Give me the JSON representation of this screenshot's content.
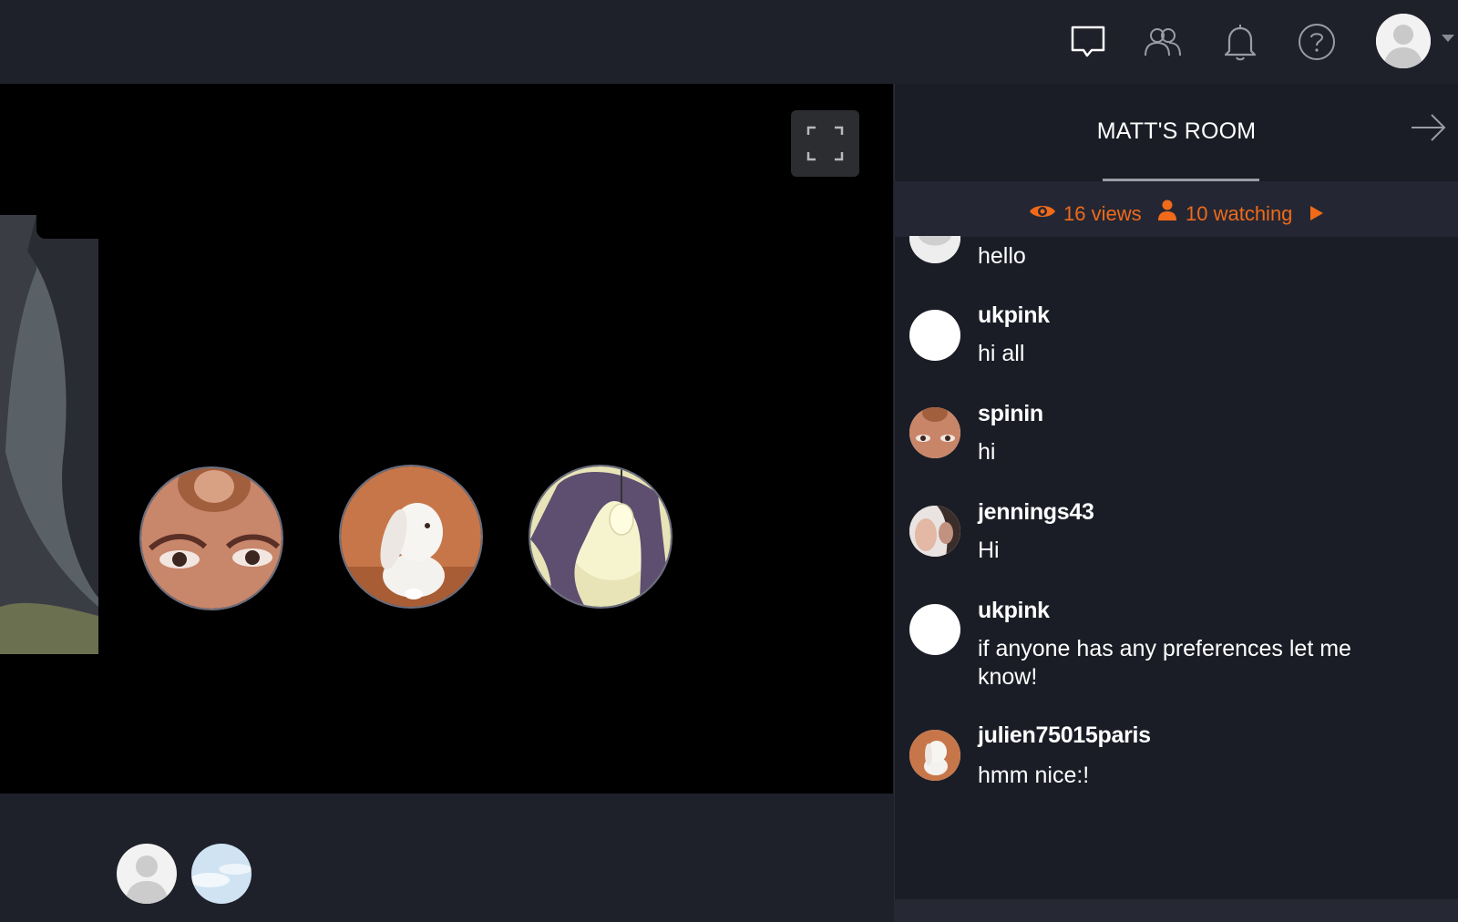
{
  "header": {
    "icons": [
      "chat-icon",
      "people-icon",
      "bell-icon",
      "help-icon"
    ],
    "profile_menu": "user-avatar"
  },
  "room": {
    "title": "MATT'S ROOM",
    "views": "16 views",
    "watching": "10 watching"
  },
  "messages": [
    {
      "user": "",
      "text": "hello",
      "avatar": "placeholder"
    },
    {
      "user": "ukpink",
      "text": "hi all",
      "avatar": "white"
    },
    {
      "user": "spinin",
      "text": "hi",
      "avatar": "eyes"
    },
    {
      "user": "jennings43",
      "text": "Hi",
      "avatar": "faces"
    },
    {
      "user": "ukpink",
      "text": "if anyone has any preferences let me know!",
      "avatar": "white"
    },
    {
      "user": "julien75015paris",
      "text": "hmm nice:!",
      "avatar": "bunny"
    }
  ],
  "colors": {
    "accent": "#f06a1a",
    "background": "#1f212a",
    "panel": "#1b1d26"
  }
}
